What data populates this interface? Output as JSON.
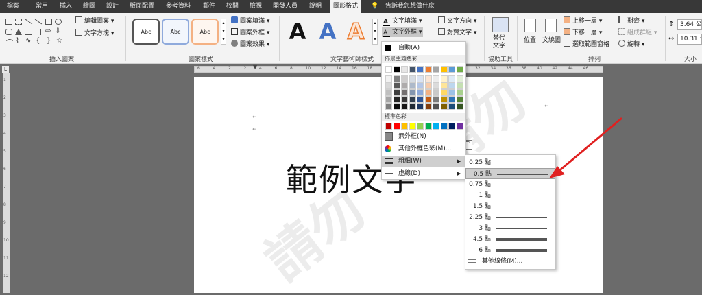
{
  "tabs": [
    "檔案",
    "常用",
    "插入",
    "繪圖",
    "設計",
    "版面配置",
    "參考資料",
    "郵件",
    "校閱",
    "檢視",
    "開發人員",
    "說明",
    "圖形格式"
  ],
  "tell_me": "告訴我您想做什麼",
  "ribbon": {
    "edit_shape": "編輯圖案",
    "text_box": "文字方塊",
    "style_sample": "Abc",
    "shape_fill": "圖案填滿",
    "shape_outline": "圖案外框",
    "shape_effects": "圖案效果",
    "wordart_sample": "A",
    "text_fill": "文字填滿",
    "text_outline": "文字外框",
    "text_direction": "文字方向",
    "align_text": "對齊文字",
    "alt_text": [
      "替代",
      "文字"
    ],
    "position": "位置",
    "wrap_text": "文繞圖",
    "bring_forward": "上移一層",
    "send_backward": "下移一層",
    "selection_pane": "選取範圍窗格",
    "align": "對齊",
    "group": "組成群組",
    "rotate": "旋轉",
    "height": "3.64 公",
    "width": "10.31 公",
    "groups": [
      "插入圖案",
      "圖案樣式",
      "文字藝術師樣式",
      "協助工具",
      "排列",
      "大小"
    ]
  },
  "ruler": {
    "h_numbers": [
      "6",
      "4",
      "2",
      "2",
      "4",
      "6",
      "8",
      "10",
      "12",
      "14",
      "16",
      "18",
      "20",
      "22",
      "24",
      "26",
      "28",
      "30",
      "32",
      "34",
      "36",
      "38",
      "40",
      "42",
      "44",
      "46"
    ],
    "v_numbers": [
      "1",
      "2",
      "3",
      "4",
      "5",
      "6",
      "7",
      "8",
      "9",
      "10",
      "11",
      "12"
    ]
  },
  "document": {
    "sample_text": "範例文字",
    "pilcrow": "↵",
    "watermark": "請勿"
  },
  "color_menu": {
    "auto": "自動(A)",
    "theme_colors": "佈景主題色彩",
    "standard_colors": "標準色彩",
    "no_outline": "無外框(N)",
    "more_colors": "其他外框色彩(M)...",
    "weight": "粗細(W)",
    "dashes": "虛線(D)",
    "theme_top": [
      "#ffffff",
      "#000000",
      "#e7e6e6",
      "#44546a",
      "#4472c4",
      "#ed7d31",
      "#a5a5a5",
      "#ffc000",
      "#5b9bd5",
      "#70ad47"
    ],
    "theme_shades": [
      [
        "#f2f2f2",
        "#7f7f7f",
        "#d0cece",
        "#d6dce4",
        "#dae3f3",
        "#fbe5d5",
        "#ededed",
        "#fff2cc",
        "#deebf6",
        "#e2efd9"
      ],
      [
        "#d8d8d8",
        "#595959",
        "#aeabab",
        "#adb9ca",
        "#b4c6e7",
        "#f7cbac",
        "#dbdbdb",
        "#fee599",
        "#bdd7ee",
        "#c5e0b3"
      ],
      [
        "#bfbfbf",
        "#3f3f3f",
        "#757070",
        "#8496b0",
        "#8eaadb",
        "#f4b183",
        "#c9c9c9",
        "#ffd965",
        "#9dc3e6",
        "#a8d08d"
      ],
      [
        "#a5a5a5",
        "#262626",
        "#3a3838",
        "#323f4f",
        "#2f5496",
        "#c55a11",
        "#7b7b7b",
        "#bf9000",
        "#2e75b5",
        "#538135"
      ],
      [
        "#7f7f7f",
        "#0c0c0c",
        "#171616",
        "#222a35",
        "#1f3864",
        "#833c0b",
        "#525252",
        "#7f6000",
        "#1e4e79",
        "#375623"
      ]
    ],
    "standard": [
      "#c00000",
      "#ff0000",
      "#ffc000",
      "#ffff00",
      "#92d050",
      "#00b050",
      "#00b0f0",
      "#0070c0",
      "#002060",
      "#7030a0"
    ]
  },
  "weight_menu": {
    "items": [
      {
        "label": "0.25 點",
        "pt": 0.25
      },
      {
        "label": "0.5 點",
        "pt": 0.5
      },
      {
        "label": "0.75 點",
        "pt": 0.75
      },
      {
        "label": "1 點",
        "pt": 1
      },
      {
        "label": "1.5 點",
        "pt": 1.5
      },
      {
        "label": "2.25 點",
        "pt": 2.25
      },
      {
        "label": "3 點",
        "pt": 3
      },
      {
        "label": "4.5 點",
        "pt": 4.5
      },
      {
        "label": "6 點",
        "pt": 6
      }
    ],
    "selected_index": 1,
    "more_lines": "其他線條(M)..."
  },
  "colors": {
    "accent_arrow": "#e02020",
    "tab_bar": "#383838"
  }
}
